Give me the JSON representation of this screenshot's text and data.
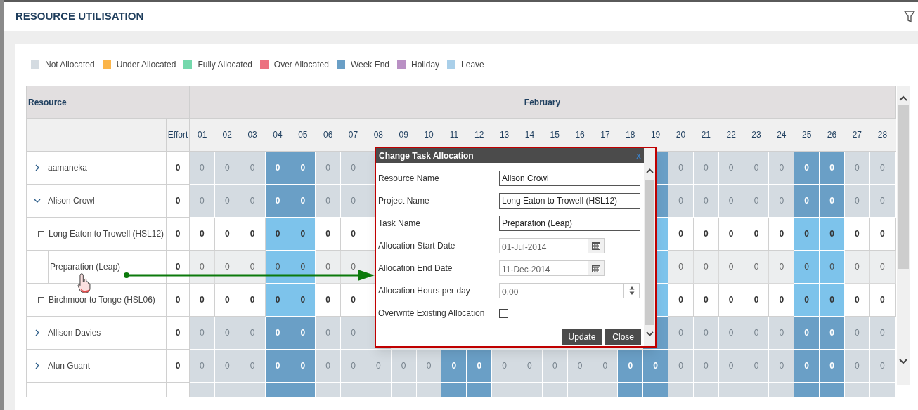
{
  "title": "RESOURCE UTILISATION",
  "legend": [
    {
      "label": "Not Allocated",
      "color": "#d4dbe1"
    },
    {
      "label": "Under Allocated",
      "color": "#fbb54a"
    },
    {
      "label": "Fully Allocated",
      "color": "#74d8ac"
    },
    {
      "label": "Over Allocated",
      "color": "#ec7180"
    },
    {
      "label": "Week End",
      "color": "#6a9fc6"
    },
    {
      "label": "Holiday",
      "color": "#b990c4"
    },
    {
      "label": "Leave",
      "color": "#a9cfe9"
    }
  ],
  "table": {
    "resource_header": "Resource",
    "month": "February",
    "effort_header": "Effort",
    "days": [
      "01",
      "02",
      "03",
      "04",
      "05",
      "06",
      "07",
      "08",
      "09",
      "10",
      "11",
      "12",
      "13",
      "14",
      "15",
      "16",
      "17",
      "18",
      "19",
      "20",
      "21",
      "22",
      "23",
      "24",
      "25",
      "26",
      "27",
      "28"
    ],
    "rows": [
      {
        "kind": "resource",
        "name": "aamaneka",
        "expanded": false,
        "effort": "0",
        "cells": [
          {
            "kind": "free",
            "value": "0"
          },
          {
            "kind": "free",
            "value": "0"
          },
          {
            "kind": "free",
            "value": "0"
          },
          {
            "kind": "weekend",
            "value": "0"
          },
          {
            "kind": "weekend",
            "value": "0"
          },
          {
            "kind": "free",
            "value": "0"
          },
          {
            "kind": "free",
            "value": "0"
          },
          {
            "kind": "free"
          },
          null,
          null,
          null,
          null,
          null,
          null,
          null,
          null,
          null,
          null,
          {
            "kind": "weekend"
          },
          {
            "kind": "free",
            "value": "0"
          },
          {
            "kind": "free",
            "value": "0"
          },
          {
            "kind": "free",
            "value": "0"
          },
          {
            "kind": "free",
            "value": "0"
          },
          {
            "kind": "free",
            "value": "0"
          },
          {
            "kind": "weekend",
            "value": "0"
          },
          {
            "kind": "weekend",
            "value": "0"
          },
          {
            "kind": "free",
            "value": "0"
          },
          {
            "kind": "free",
            "value": "0"
          }
        ]
      },
      {
        "kind": "resource",
        "name": "Alison Crowl",
        "expanded": true,
        "effort": "0",
        "cells": [
          {
            "kind": "free",
            "value": "0"
          },
          {
            "kind": "free",
            "value": "0"
          },
          {
            "kind": "free",
            "value": "0"
          },
          {
            "kind": "weekend",
            "value": "0"
          },
          {
            "kind": "weekend",
            "value": "0"
          },
          {
            "kind": "free",
            "value": "0"
          },
          {
            "kind": "free",
            "value": "0"
          },
          {
            "kind": "free"
          },
          null,
          null,
          null,
          null,
          null,
          null,
          null,
          null,
          null,
          null,
          {
            "kind": "weekend"
          },
          {
            "kind": "free",
            "value": "0"
          },
          {
            "kind": "free",
            "value": "0"
          },
          {
            "kind": "free",
            "value": "0"
          },
          {
            "kind": "free",
            "value": "0"
          },
          {
            "kind": "free",
            "value": "0"
          },
          {
            "kind": "weekend",
            "value": "0"
          },
          {
            "kind": "weekend",
            "value": "0"
          },
          {
            "kind": "free",
            "value": "0"
          },
          {
            "kind": "free",
            "value": "0"
          }
        ],
        "children": [
          {
            "kind": "project",
            "name": "Long Eaton to Trowell (HSL12)",
            "expanded": true,
            "effort": "0",
            "cells": [
              {
                "kind": "free",
                "value": "0"
              },
              {
                "kind": "free",
                "value": "0"
              },
              {
                "kind": "free",
                "value": "0"
              },
              {
                "kind": "weekend",
                "value": "0"
              },
              {
                "kind": "weekend",
                "value": "0"
              },
              {
                "kind": "free",
                "value": "0"
              },
              {
                "kind": "free",
                "value": "0"
              },
              {
                "kind": "free"
              },
              null,
              null,
              null,
              null,
              null,
              null,
              null,
              null,
              null,
              null,
              {
                "kind": "weekend"
              },
              {
                "kind": "free",
                "value": "0"
              },
              {
                "kind": "free",
                "value": "0"
              },
              {
                "kind": "free",
                "value": "0"
              },
              {
                "kind": "free",
                "value": "0"
              },
              {
                "kind": "free",
                "value": "0"
              },
              {
                "kind": "weekend",
                "value": "0"
              },
              {
                "kind": "weekend",
                "value": "0"
              },
              {
                "kind": "free",
                "value": "0"
              },
              {
                "kind": "free",
                "value": "0"
              }
            ],
            "children": [
              {
                "kind": "task",
                "name": "Preparation (Leap)",
                "effort": "0",
                "cells": [
                  {
                    "kind": "free",
                    "value": "0"
                  },
                  {
                    "kind": "free",
                    "value": "0"
                  },
                  {
                    "kind": "free",
                    "value": "0"
                  },
                  {
                    "kind": "weekend",
                    "value": "0"
                  },
                  {
                    "kind": "weekend",
                    "value": "0"
                  },
                  {
                    "kind": "free",
                    "value": "0"
                  },
                  {
                    "kind": "free",
                    "value": "0"
                  },
                  {
                    "kind": "free"
                  },
                  null,
                  null,
                  null,
                  null,
                  null,
                  null,
                  null,
                  null,
                  null,
                  null,
                  {
                    "kind": "weekend"
                  },
                  {
                    "kind": "free",
                    "value": "0"
                  },
                  {
                    "kind": "free",
                    "value": "0"
                  },
                  {
                    "kind": "free",
                    "value": "0"
                  },
                  {
                    "kind": "free",
                    "value": "0"
                  },
                  {
                    "kind": "free",
                    "value": "0"
                  },
                  {
                    "kind": "weekend",
                    "value": "0"
                  },
                  {
                    "kind": "weekend",
                    "value": "0"
                  },
                  {
                    "kind": "free",
                    "value": "0"
                  },
                  {
                    "kind": "free",
                    "value": "0"
                  }
                ]
              }
            ]
          },
          {
            "kind": "project",
            "name": "Birchmoor to Tonge (HSL06)",
            "expanded": false,
            "effort": "0",
            "cells": [
              {
                "kind": "free",
                "value": "0"
              },
              {
                "kind": "free",
                "value": "0"
              },
              {
                "kind": "free",
                "value": "0"
              },
              {
                "kind": "weekend",
                "value": "0"
              },
              {
                "kind": "weekend",
                "value": "0"
              },
              {
                "kind": "free",
                "value": "0"
              },
              {
                "kind": "free",
                "value": "0"
              },
              {
                "kind": "free"
              },
              null,
              null,
              null,
              null,
              null,
              null,
              null,
              null,
              null,
              null,
              {
                "kind": "weekend"
              },
              {
                "kind": "free",
                "value": "0"
              },
              {
                "kind": "free",
                "value": "0"
              },
              {
                "kind": "free",
                "value": "0"
              },
              {
                "kind": "free",
                "value": "0"
              },
              {
                "kind": "free",
                "value": "0"
              },
              {
                "kind": "weekend",
                "value": "0"
              },
              {
                "kind": "weekend",
                "value": "0"
              },
              {
                "kind": "free",
                "value": "0"
              },
              {
                "kind": "free",
                "value": "0"
              }
            ]
          }
        ]
      },
      {
        "kind": "resource",
        "name": "Allison Davies",
        "expanded": false,
        "effort": "0",
        "cells": [
          {
            "kind": "free",
            "value": "0"
          },
          {
            "kind": "free",
            "value": "0"
          },
          {
            "kind": "free",
            "value": "0"
          },
          {
            "kind": "weekend",
            "value": "0"
          },
          {
            "kind": "weekend",
            "value": "0"
          },
          {
            "kind": "free",
            "value": "0"
          },
          {
            "kind": "free",
            "value": "0"
          },
          {
            "kind": "free"
          },
          null,
          null,
          null,
          null,
          null,
          null,
          null,
          null,
          null,
          null,
          {
            "kind": "weekend"
          },
          {
            "kind": "free",
            "value": "0"
          },
          {
            "kind": "free",
            "value": "0"
          },
          {
            "kind": "free",
            "value": "0"
          },
          {
            "kind": "free",
            "value": "0"
          },
          {
            "kind": "free",
            "value": "0"
          },
          {
            "kind": "weekend",
            "value": "0"
          },
          {
            "kind": "weekend",
            "value": "0"
          },
          {
            "kind": "free",
            "value": "0"
          },
          {
            "kind": "free",
            "value": "0"
          }
        ]
      },
      {
        "kind": "resource",
        "name": "Alun Guant",
        "expanded": false,
        "effort": "0",
        "cells": [
          {
            "kind": "free",
            "value": "0"
          },
          {
            "kind": "free",
            "value": "0"
          },
          {
            "kind": "free",
            "value": "0"
          },
          {
            "kind": "weekend",
            "value": "0"
          },
          {
            "kind": "weekend",
            "value": "0"
          },
          {
            "kind": "free",
            "value": "0"
          },
          {
            "kind": "free",
            "value": "0"
          },
          {
            "kind": "free",
            "value": "0"
          },
          {
            "kind": "free",
            "value": "0"
          },
          {
            "kind": "free",
            "value": "0"
          },
          {
            "kind": "weekend",
            "value": "0"
          },
          {
            "kind": "weekend",
            "value": "0"
          },
          {
            "kind": "free",
            "value": "0"
          },
          {
            "kind": "free",
            "value": "0"
          },
          {
            "kind": "free",
            "value": "0"
          },
          {
            "kind": "free",
            "value": "0"
          },
          {
            "kind": "free",
            "value": "0"
          },
          {
            "kind": "weekend",
            "value": "0"
          },
          {
            "kind": "weekend",
            "value": "0"
          },
          {
            "kind": "free",
            "value": "0"
          },
          {
            "kind": "free",
            "value": "0"
          },
          {
            "kind": "free",
            "value": "0"
          },
          {
            "kind": "free",
            "value": "0"
          },
          {
            "kind": "free",
            "value": "0"
          },
          {
            "kind": "weekend",
            "value": "0"
          },
          {
            "kind": "weekend",
            "value": "0"
          },
          {
            "kind": "free",
            "value": "0"
          },
          {
            "kind": "free",
            "value": "0"
          }
        ]
      },
      {
        "kind": "resource",
        "cells": [
          {
            "kind": "free"
          },
          {
            "kind": "free"
          },
          {
            "kind": "free"
          },
          {
            "kind": "weekend"
          },
          {
            "kind": "weekend"
          },
          {
            "kind": "free"
          },
          {
            "kind": "free"
          },
          {
            "kind": "free"
          },
          {
            "kind": "free"
          },
          {
            "kind": "free"
          },
          {
            "kind": "weekend"
          },
          {
            "kind": "weekend"
          },
          {
            "kind": "free"
          },
          {
            "kind": "free"
          },
          {
            "kind": "free"
          },
          {
            "kind": "free"
          },
          {
            "kind": "free"
          },
          {
            "kind": "weekend"
          },
          {
            "kind": "weekend"
          },
          {
            "kind": "free"
          },
          {
            "kind": "free"
          },
          {
            "kind": "free"
          },
          {
            "kind": "free"
          },
          {
            "kind": "free"
          },
          {
            "kind": "weekend"
          },
          {
            "kind": "weekend"
          },
          {
            "kind": "free"
          },
          {
            "kind": "free"
          }
        ]
      }
    ]
  },
  "dialog": {
    "title": "Change Task Allocation",
    "close": "x",
    "fields": [
      {
        "kind": "text",
        "label": "Resource Name",
        "value": "Alison Crowl"
      },
      {
        "kind": "text",
        "label": "Project Name",
        "value": "Long Eaton to Trowell (HSL12)"
      },
      {
        "kind": "text",
        "label": "Task Name",
        "value": "Preparation (Leap)"
      },
      {
        "kind": "date",
        "label": "Allocation Start Date",
        "value": "01-Jul-2014"
      },
      {
        "kind": "date",
        "label": "Allocation End Date",
        "value": "11-Dec-2014"
      },
      {
        "kind": "number",
        "label": "Allocation Hours per day",
        "value": "0.00"
      },
      {
        "kind": "checkbox",
        "label": "Overwrite Existing Allocation",
        "checked": false
      }
    ],
    "buttons": [
      "Update",
      "Close"
    ]
  }
}
